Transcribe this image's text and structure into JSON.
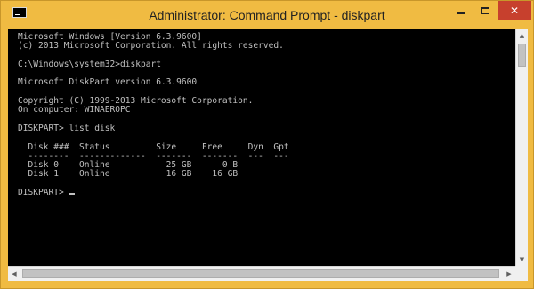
{
  "window": {
    "title": "Administrator: Command Prompt - diskpart",
    "icon": "cmd-icon",
    "accent_color": "#f0bb42",
    "close_color": "#c7402d",
    "controls": {
      "minimize": "minimize-icon",
      "maximize": "maximize-icon",
      "close": "✕"
    }
  },
  "console": {
    "background": "#000000",
    "foreground": "#c0c0c0",
    "lines": [
      "Microsoft Windows [Version 6.3.9600]",
      "(c) 2013 Microsoft Corporation. All rights reserved.",
      "",
      "C:\\Windows\\system32>diskpart",
      "",
      "Microsoft DiskPart version 6.3.9600",
      "",
      "Copyright (C) 1999-2013 Microsoft Corporation.",
      "On computer: WINAEROPC",
      "",
      "DISKPART> list disk",
      "",
      "  Disk ###  Status         Size     Free     Dyn  Gpt",
      "  --------  -------------  -------  -------  ---  ---",
      "  Disk 0    Online           25 GB      0 B",
      "  Disk 1    Online           16 GB    16 GB",
      ""
    ],
    "prompt": "DISKPART> "
  },
  "scrollbars": {
    "up": "▲",
    "down": "▼",
    "left": "◀",
    "right": "▶"
  }
}
